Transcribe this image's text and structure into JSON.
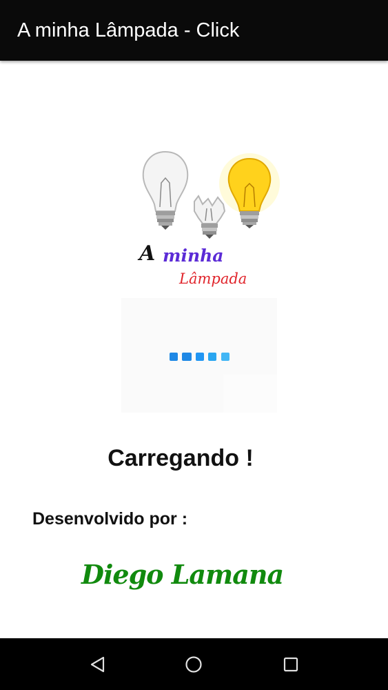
{
  "app_bar": {
    "title": "A minha Lâmpada - Click"
  },
  "logo": {
    "line1_a": "A",
    "line1_rest": "minha",
    "line2": "Lâmpada"
  },
  "loader": {
    "colors": [
      "#1e88e5",
      "#1e88e5",
      "#2196f3",
      "#29a6f0",
      "#42b6f5"
    ]
  },
  "status": {
    "loading": "Carregando !"
  },
  "credits": {
    "label": "Desenvolvido por :",
    "author": "Diego Lamana"
  },
  "colors": {
    "author": "#118a0e",
    "minha": "#5b2bd6",
    "lampada": "#e0242b"
  },
  "navigation": {
    "icons": [
      "back-icon",
      "home-icon",
      "recents-icon"
    ]
  }
}
